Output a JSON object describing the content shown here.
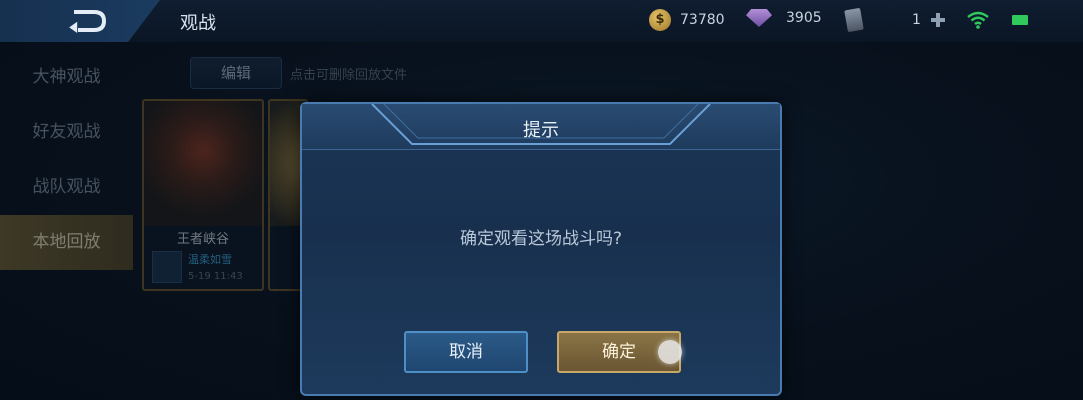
{
  "topbar": {
    "title": "观战",
    "coins": "73780",
    "gems": "3905",
    "cards": "1"
  },
  "sidebar": {
    "items": [
      {
        "label": "大神观战"
      },
      {
        "label": "好友观战"
      },
      {
        "label": "战队观战"
      },
      {
        "label": "本地回放"
      }
    ]
  },
  "content": {
    "edit_label": "编辑",
    "hint": "点击可删除回放文件",
    "cards": [
      {
        "mode": "王者峡谷",
        "player": "温柔如雪",
        "time": "5-19 11:43"
      }
    ]
  },
  "dialog": {
    "title": "提示",
    "message": "确定观看这场战斗吗?",
    "cancel_label": "取消",
    "ok_label": "确定"
  },
  "colors": {
    "accent_gold": "#c8a868",
    "accent_blue": "#4f8fc8"
  }
}
